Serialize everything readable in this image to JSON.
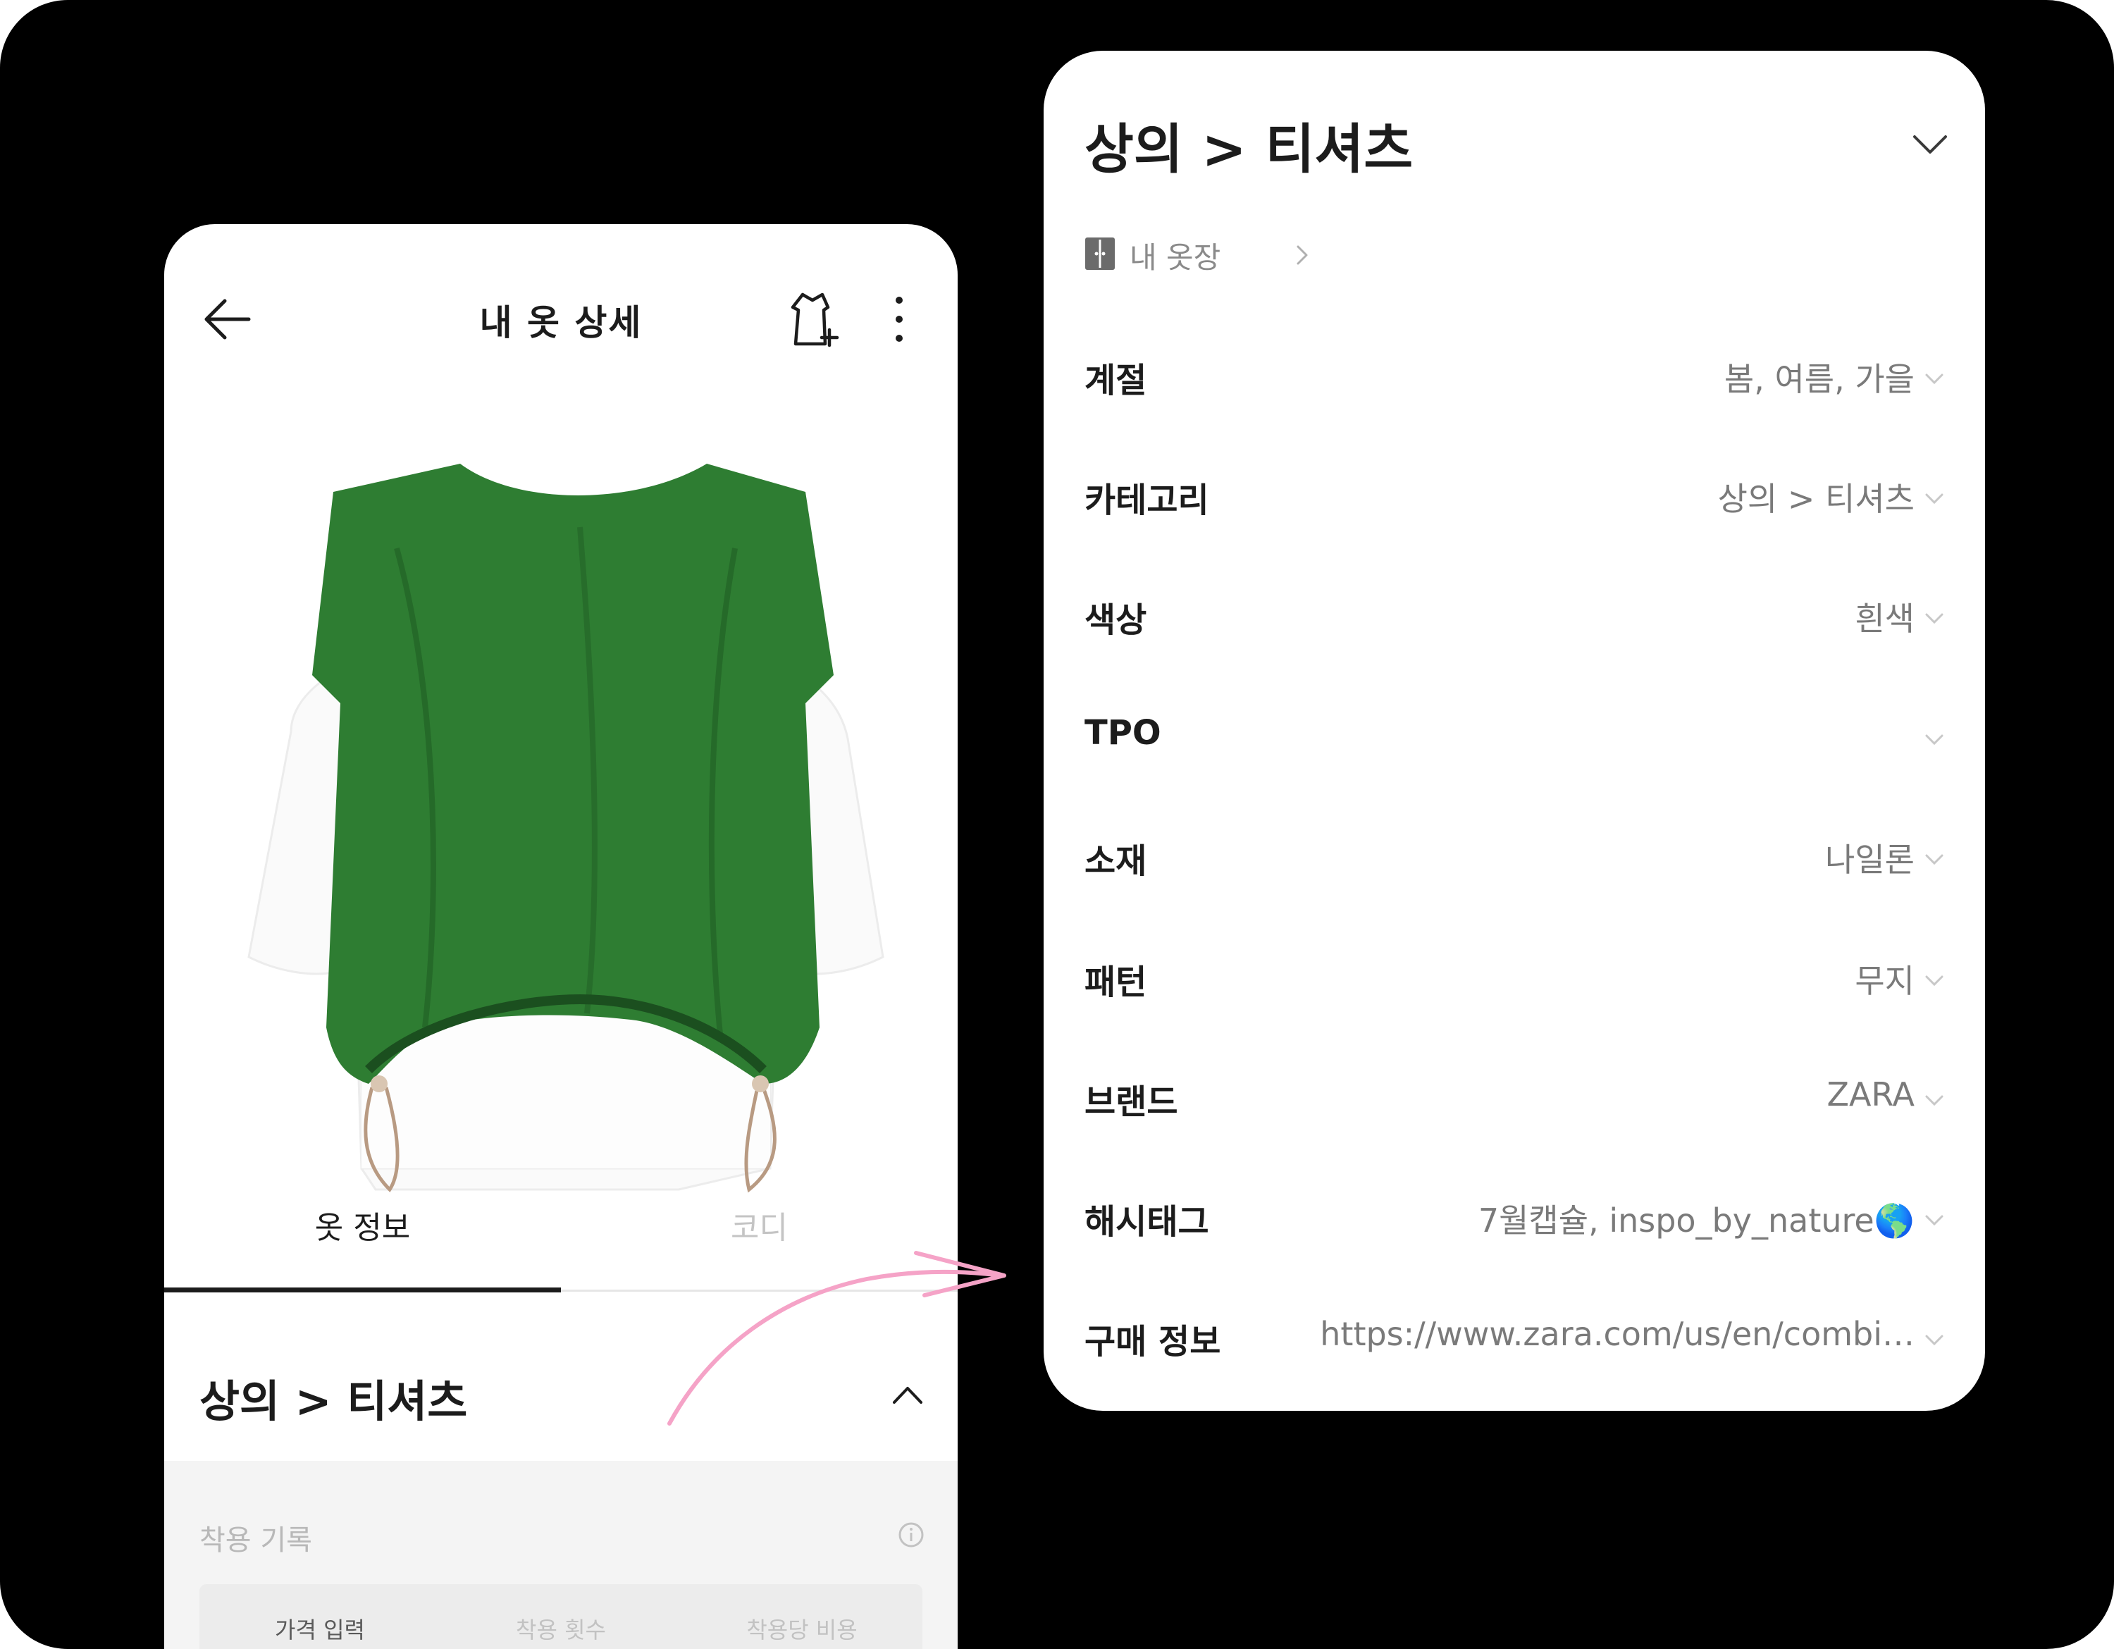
{
  "left_screen": {
    "title": "내 옷 상세",
    "tabs": [
      {
        "label": "옷 정보",
        "active": true
      },
      {
        "label": "코디",
        "active": false
      }
    ],
    "category": "상의 > 티셔츠",
    "wear_record": {
      "title": "착용 기록",
      "columns": [
        "가격 입력",
        "착용 횟수",
        "착용당 비용"
      ]
    }
  },
  "right_screen": {
    "title": "상의 > 티셔츠",
    "breadcrumb": "내 옷장",
    "rows": [
      {
        "label": "계절",
        "value": "봄, 여름, 가을"
      },
      {
        "label": "카테고리",
        "value": "상의 > 티셔츠"
      },
      {
        "label": "색상",
        "value": "흰색"
      },
      {
        "label": "TPO",
        "value": ""
      },
      {
        "label": "소재",
        "value": "나일론"
      },
      {
        "label": "패턴",
        "value": "무지"
      },
      {
        "label": "브랜드",
        "value": "ZARA"
      },
      {
        "label": "해시태그",
        "value": "7월캡슐, inspo_by_nature🌎"
      },
      {
        "label": "구매 정보",
        "value": "https://www.zara.com/us/en/combi…"
      }
    ]
  },
  "colors": {
    "background": "#000000",
    "card": "#ffffff",
    "garment_green": "#2e7d32",
    "arrow_pink": "#f5a3c7",
    "muted_text": "#7a7a7a"
  },
  "icons": [
    "back-arrow-icon",
    "outfit-add-icon",
    "more-vertical-icon",
    "chevron-up-icon",
    "info-icon",
    "closet-icon",
    "chevron-right-icon",
    "chevron-down-icon"
  ]
}
